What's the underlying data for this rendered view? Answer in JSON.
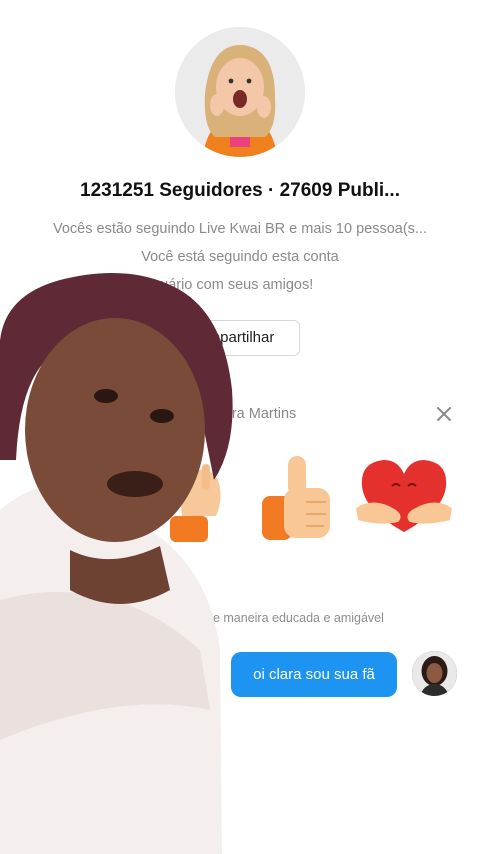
{
  "profile": {
    "stats": "1231251 Seguidores · 27609 Publi...",
    "following_info": "Vocês estão seguindo Live Kwai BR e mais 10 pessoa(s...",
    "following_status": "Você está seguindo esta conta",
    "share_prompt": "lhe este usuário com seus amigos!",
    "share_button": "mpartilhar"
  },
  "greeting_panel": {
    "recipient": "a Clara Martins",
    "hint": "de maneira educada e amigável"
  },
  "message": {
    "text": "oi clara sou sua fã"
  }
}
